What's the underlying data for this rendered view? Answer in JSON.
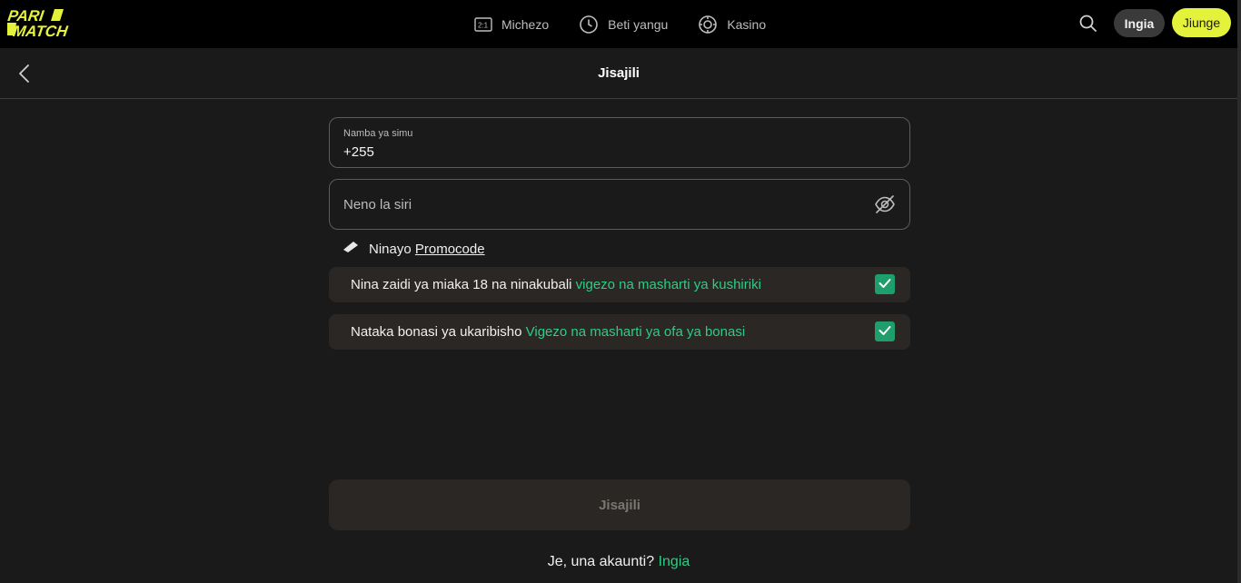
{
  "header": {
    "logo_text": "PARI MATCH",
    "nav": [
      {
        "label": "Michezo",
        "icon": "scoreboard-icon"
      },
      {
        "label": "Beti yangu",
        "icon": "clock-icon"
      },
      {
        "label": "Kasino",
        "icon": "casino-chip-icon"
      }
    ],
    "login_label": "Ingia",
    "join_label": "Jiunge"
  },
  "subheader": {
    "title": "Jisajili"
  },
  "form": {
    "phone": {
      "label": "Namba ya simu",
      "value": "+255"
    },
    "password": {
      "placeholder": "Neno la siri"
    },
    "promo": {
      "prefix": "Ninayo",
      "link": "Promocode"
    },
    "terms": {
      "text": "Nina zaidi ya miaka 18 na ninakubali",
      "link": "vigezo na masharti ya kushiriki",
      "checked": true
    },
    "bonus": {
      "text": "Nataka bonasi ya ukaribisho",
      "link": "Vigezo na masharti ya ofa ya bonasi",
      "checked": true
    },
    "submit_label": "Jisajili"
  },
  "footer": {
    "question": "Je, una akaunti?",
    "link": "Ingia"
  },
  "colors": {
    "brand_yellow": "#e5f23c",
    "link_green": "#2ecc85",
    "checkbox_green": "#1e9e6b",
    "background": "#1a1a1a"
  }
}
